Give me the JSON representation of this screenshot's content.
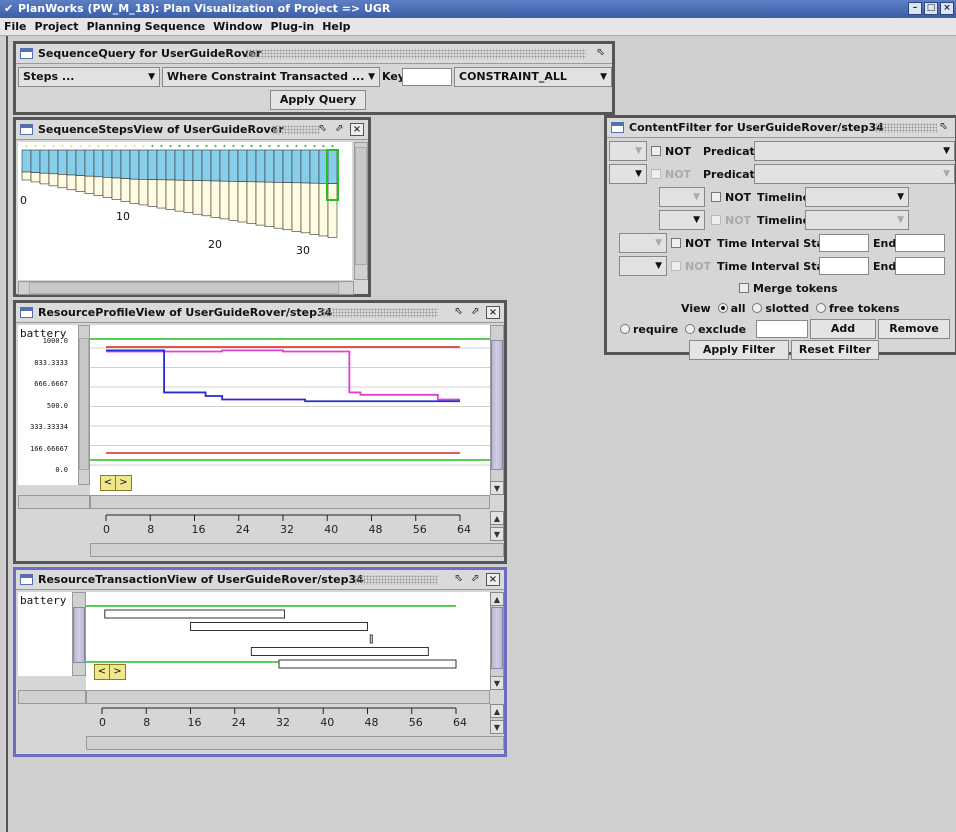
{
  "app": {
    "title": "PlanWorks (PW_M_18): Plan Visualization of Project =>  UGR",
    "menu": [
      "File",
      "Project",
      "Planning Sequence",
      "Window",
      "Plug-in",
      "Help"
    ]
  },
  "query_window": {
    "title": "SequenceQuery for UserGuideRover",
    "steps_combo": "Steps ...",
    "where_combo": "Where Constraint Transacted ...",
    "key_label": "Key",
    "key_value": "",
    "constraint_combo": "CONSTRAINT_ALL",
    "apply_button": "Apply Query"
  },
  "steps_window": {
    "title": "SequenceStepsView of UserGuideRover",
    "axis_labels": [
      "0",
      "10",
      "20",
      "30"
    ]
  },
  "filter_window": {
    "title": "ContentFilter for UserGuideRover/step34",
    "not_label": "NOT",
    "predicate_label": "Predicate",
    "timeline_label": "Timeline",
    "time_interval_label": "Time Interval Start",
    "end_label": "End",
    "merge_label": "Merge tokens",
    "view_label": "View",
    "view_all": "all",
    "view_slotted": "slotted",
    "view_free": "free tokens",
    "require_label": "require",
    "exclude_label": "exclude",
    "add_button": "Add",
    "remove_button": "Remove",
    "apply_filter_button": "Apply Filter",
    "reset_filter_button": "Reset Filter"
  },
  "profile_window": {
    "title": "ResourceProfileView of UserGuideRover/step34",
    "resource_name": "battery",
    "y_ticks": [
      "1000.0",
      "833.3333",
      "666.6667",
      "500.0",
      "333.33334",
      "166.66667",
      "0.0"
    ],
    "x_ticks": [
      "0",
      "8",
      "16",
      "24",
      "32",
      "40",
      "48",
      "56",
      "64"
    ],
    "colors": {
      "limit": "#e02020",
      "bound": "#20c020",
      "min_profile": "#2a2ad6",
      "max_profile": "#e040d0"
    },
    "min_profile": [
      [
        0,
        980
      ],
      [
        10.5,
        980
      ],
      [
        10.5,
        620
      ],
      [
        18,
        620
      ],
      [
        18,
        590
      ],
      [
        21,
        590
      ],
      [
        21,
        560
      ],
      [
        36,
        560
      ],
      [
        36,
        545
      ],
      [
        64,
        545
      ]
    ],
    "max_profile": [
      [
        0,
        970
      ],
      [
        21,
        970
      ],
      [
        21,
        980
      ],
      [
        32,
        980
      ],
      [
        32,
        970
      ],
      [
        44,
        970
      ],
      [
        44,
        620
      ],
      [
        46,
        620
      ],
      [
        46,
        600
      ],
      [
        60,
        600
      ],
      [
        60,
        560
      ],
      [
        64,
        560
      ]
    ]
  },
  "transaction_window": {
    "title": "ResourceTransactionView of UserGuideRover/step34",
    "resource_name": "battery",
    "x_ticks": [
      "0",
      "8",
      "16",
      "24",
      "32",
      "40",
      "48",
      "56",
      "64"
    ],
    "transactions": [
      [
        0.5,
        33
      ],
      [
        16,
        48
      ],
      [
        48.5,
        48.5
      ],
      [
        27,
        59
      ],
      [
        32,
        64
      ]
    ]
  }
}
